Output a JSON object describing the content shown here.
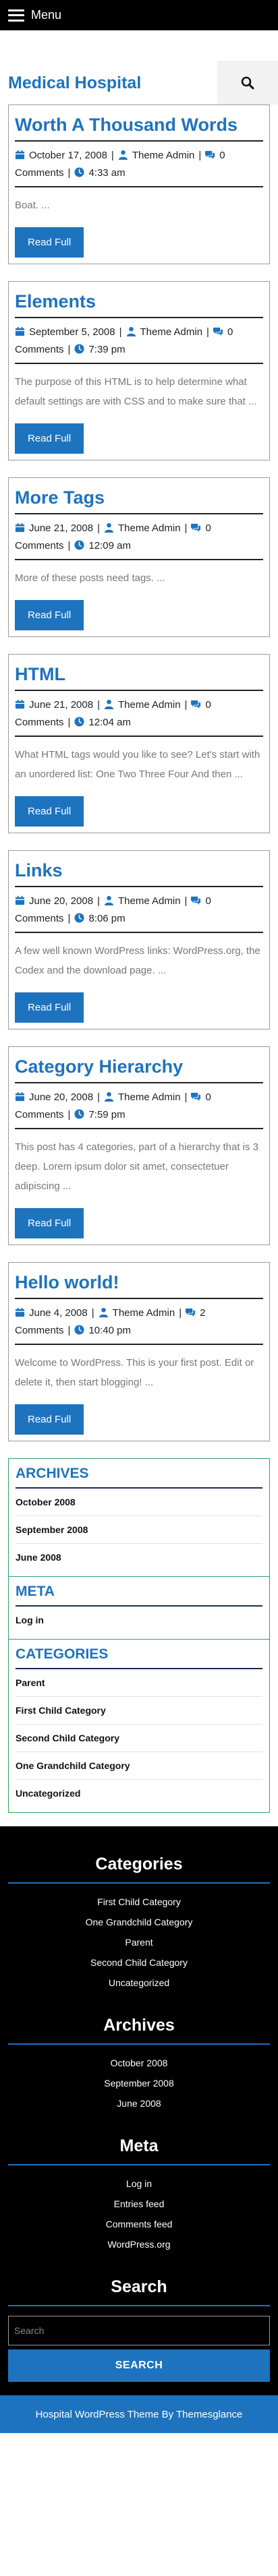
{
  "topbar": {
    "menu_label": "Menu"
  },
  "header": {
    "site_title": "Medical Hospital"
  },
  "posts": [
    {
      "title": "Worth A Thousand Words",
      "date": "October 17, 2008",
      "author": "Theme Admin",
      "comments": "0 Comments",
      "time": "4:33 am",
      "excerpt": "Boat. ...",
      "read_label": "Read Full"
    },
    {
      "title": "Elements",
      "date": "September 5, 2008",
      "author": "Theme Admin",
      "comments": "0 Comments",
      "time": "7:39 pm",
      "excerpt": "The purpose of this HTML is to help determine what default settings are with CSS and to make sure that ...",
      "read_label": "Read Full"
    },
    {
      "title": "More Tags",
      "date": "June 21, 2008",
      "author": "Theme Admin",
      "comments": "0 Comments",
      "time": "12:09 am",
      "excerpt": "More of these posts need tags. ...",
      "read_label": "Read Full"
    },
    {
      "title": "HTML",
      "date": "June 21, 2008",
      "author": "Theme Admin",
      "comments": "0 Comments",
      "time": "12:04 am",
      "excerpt": "What HTML tags would you like to see? Let's start with an unordered list: One Two Three Four And then ...",
      "read_label": "Read Full"
    },
    {
      "title": "Links",
      "date": "June 20, 2008",
      "author": "Theme Admin",
      "comments": "0 Comments",
      "time": "8:06 pm",
      "excerpt": "A few well known WordPress links: WordPress.org, the Codex and the download page. ...",
      "read_label": "Read Full"
    },
    {
      "title": "Category Hierarchy",
      "date": "June 20, 2008",
      "author": "Theme Admin",
      "comments": "0 Comments",
      "time": "7:59 pm",
      "excerpt": "This post has 4 categories, part of a hierarchy that is 3 deep. Lorem ipsum dolor sit amet, consectetuer adipiscing ...",
      "read_label": "Read Full"
    },
    {
      "title": "Hello world!",
      "date": "June 4, 2008",
      "author": "Theme Admin",
      "comments": "2 Comments",
      "time": "10:40 pm",
      "excerpt": "Welcome to WordPress. This is your first post. Edit or delete it, then start blogging! ...",
      "read_label": "Read Full"
    }
  ],
  "sidebar": {
    "archives": {
      "title": "ARCHIVES",
      "items": [
        "October 2008",
        "September 2008",
        "June 2008"
      ]
    },
    "meta": {
      "title": "META",
      "items": [
        "Log in"
      ]
    },
    "categories": {
      "title": "CATEGORIES",
      "items": [
        "Parent",
        "First Child Category",
        "Second Child Category",
        "One Grandchild Category",
        "Uncategorized"
      ]
    }
  },
  "footer": {
    "categories": {
      "title": "Categories",
      "items": [
        "First Child Category",
        "One Grandchild Category",
        "Parent",
        "Second Child Category",
        "Uncategorized"
      ]
    },
    "archives": {
      "title": "Archives",
      "items": [
        "October 2008",
        "September 2008",
        "June 2008"
      ]
    },
    "meta": {
      "title": "Meta",
      "items": [
        "Log in",
        "Entries feed",
        "Comments feed",
        "WordPress.org"
      ]
    },
    "search": {
      "title": "Search",
      "placeholder": "Search",
      "button_label": "SEARCH"
    },
    "credit": "Hospital WordPress Theme By Themesglance"
  },
  "colors": {
    "accent": "#1e73be",
    "footer_bg": "#000000",
    "widget_border": "#2fa060"
  },
  "icons": {
    "menu": "hamburger-icon",
    "search": "search-icon",
    "date": "calendar-icon",
    "author": "user-icon",
    "comments": "comments-icon",
    "time": "clock-icon"
  }
}
